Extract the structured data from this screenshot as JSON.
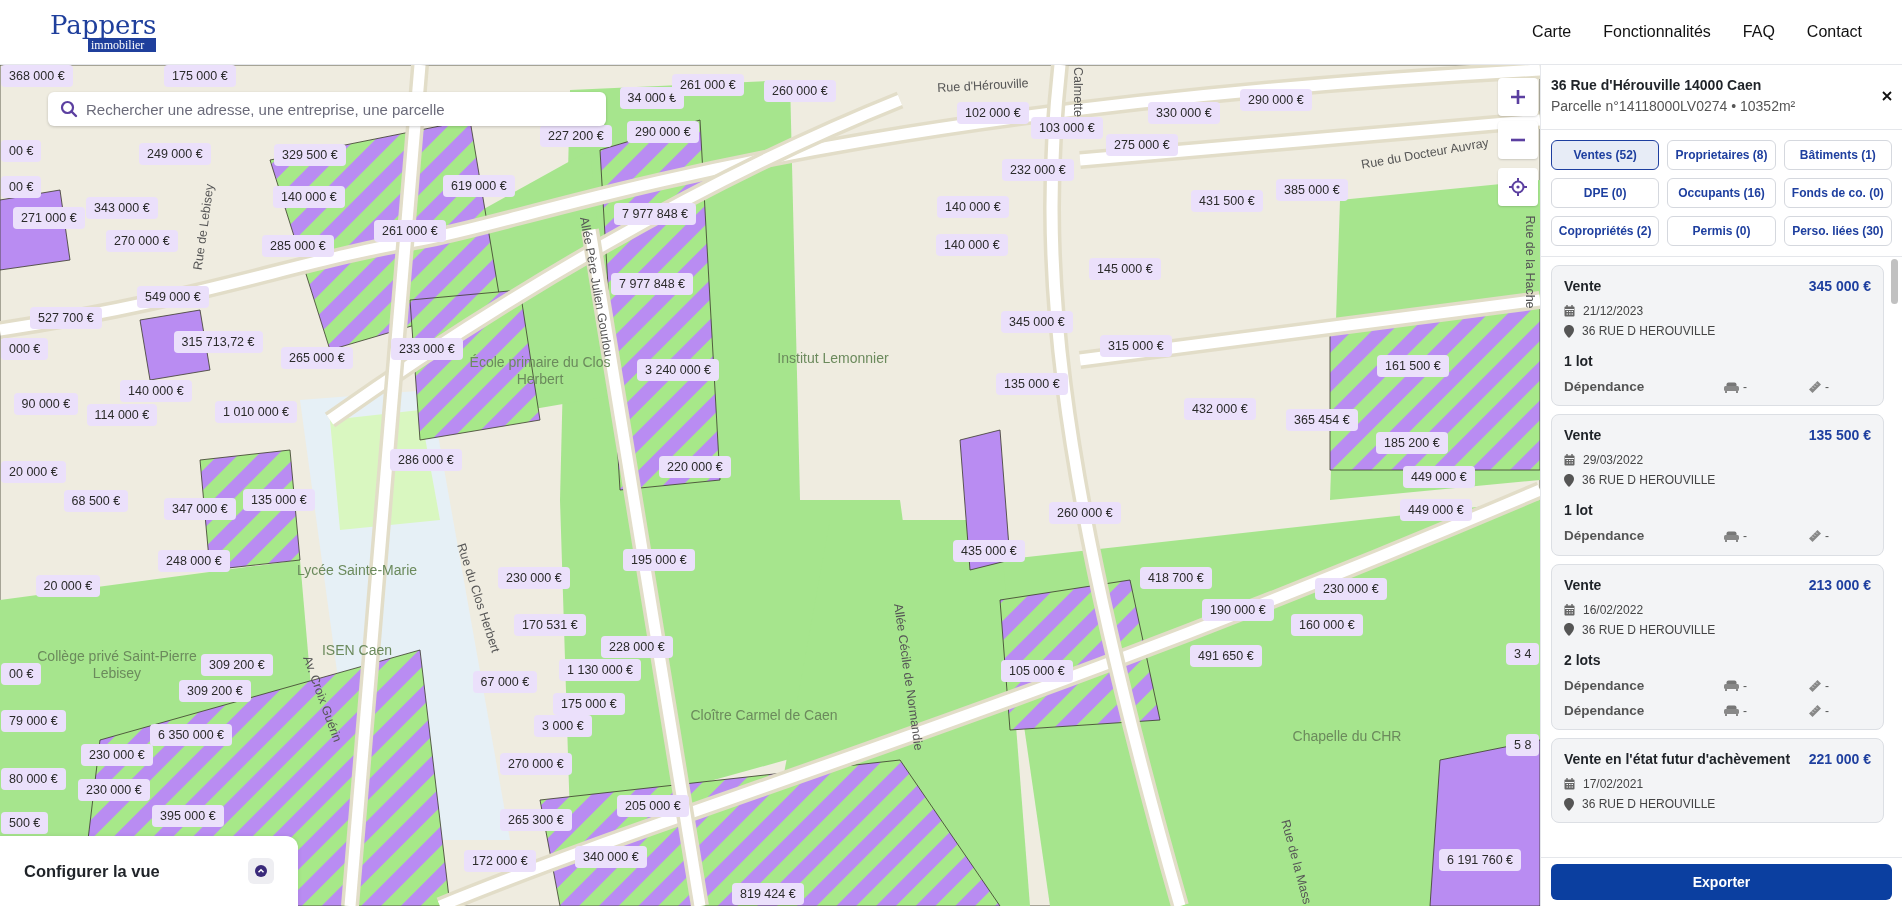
{
  "header": {
    "logo": {
      "name": "Pappers",
      "tag": "immobilier"
    },
    "nav": [
      {
        "label": "Carte"
      },
      {
        "label": "Fonctionnalités"
      },
      {
        "label": "FAQ"
      },
      {
        "label": "Contact"
      }
    ]
  },
  "map": {
    "search": {
      "placeholder": "Rechercher une adresse, une entreprise, une parcelle"
    },
    "price_labels": [
      "368 000 €",
      "175 000 €",
      "34 000 €",
      "261 000 €",
      "00 €",
      "249 000 €",
      "329 500 €",
      "227 200 €",
      "290 000 €",
      "00 €",
      "619 000 €",
      "140 000 €",
      "343 000 €",
      "271 000 €",
      "261 000 €",
      "7 977 848 €",
      "270 000 €",
      "285 000 €",
      "7 977 848 €",
      "549 000 €",
      "527 700 €",
      "000 €",
      "315 713,72 €",
      "233 000 €",
      "265 000 €",
      "3 240 000 €",
      "140 000 €",
      "90 000 €",
      "114 000 €",
      "1 010 000 €",
      "20 000 €",
      "286 000 €",
      "220 000 €",
      "260 000 €",
      "102 000 €",
      "103 000 €",
      "330 000 €",
      "290 000 €",
      "275 000 €",
      "232 000 €",
      "140 000 €",
      "431 500 €",
      "385 000 €",
      "140 000 €",
      "145 000 €",
      "345 000 €",
      "315 000 €",
      "161 500 €",
      "135 000 €",
      "432 000 €",
      "365 454 €",
      "185 200 €",
      "449 000 €",
      "68 500 €",
      "347 000 €",
      "135 000 €",
      "248 000 €",
      "20 000 €",
      "195 000 €",
      "230 000 €",
      "170 531 €",
      "228 000 €",
      "1 130 000 €",
      "67 000 €",
      "175 000 €",
      "3 000 €",
      "309 200 €",
      "309 200 €",
      "00 €",
      "79 000 €",
      "6 350 000 €",
      "230 000 €",
      "80 000 €",
      "230 000 €",
      "270 000 €",
      "205 000 €",
      "500 €",
      "265 300 €",
      "395 000 €",
      "172 000 €",
      "340 000 €",
      "819 424 €",
      "260 000 €",
      "435 000 €",
      "449 000 €",
      "418 700 €",
      "190 000 €",
      "230 000 €",
      "160 000 €",
      "491 650 €",
      "105 000 €",
      "3 4",
      "5 8",
      "6 191 760 €"
    ],
    "place_labels": [
      "École primaire du Clos Herbert",
      "Institut Lemonnier",
      "Lycée Sainte-Marie",
      "ISEN Caen",
      "Collège privé Saint-Pierre Lebisey",
      "Cloître Carmel de Caen",
      "Chapelle du CHR"
    ],
    "street_labels": [
      "Rue d'Hérouville",
      "Rue du Docteur Auvray",
      "Rue de la Hache",
      "Calmette",
      "Rue de Lebisey",
      "Allée Père Julien Gourlou",
      "Rue du Clos Herbert",
      "Av. Croix Guérin",
      "Allée Cécile de Normandie",
      "Rue de la Mass"
    ],
    "configure": {
      "title": "Configurer la vue"
    }
  },
  "panel": {
    "address": "36 Rue d'Hérouville 14000 Caen",
    "parcel": "Parcelle n°14118000LV0274 • 10352m²",
    "tabs": [
      {
        "label": "Ventes (52)",
        "selected": true
      },
      {
        "label": "Proprietaires (8)",
        "selected": false
      },
      {
        "label": "Bâtiments (1)",
        "selected": false
      },
      {
        "label": "DPE (0)",
        "selected": false
      },
      {
        "label": "Occupants (16)",
        "selected": false
      },
      {
        "label": "Fonds de co. (0)",
        "selected": false
      },
      {
        "label": "Copropriétés (2)",
        "selected": false
      },
      {
        "label": "Permis (0)",
        "selected": false
      },
      {
        "label": "Perso. liées (30)",
        "selected": false
      }
    ],
    "sales": [
      {
        "type": "Vente",
        "price": "345 000 €",
        "date": "21/12/2023",
        "address": "36 RUE D HEROUVILLE",
        "lots": "1 lot",
        "items": [
          {
            "label": "Dépendance",
            "rooms": "-",
            "area": "-"
          }
        ]
      },
      {
        "type": "Vente",
        "price": "135 500 €",
        "date": "29/03/2022",
        "address": "36 RUE D HEROUVILLE",
        "lots": "1 lot",
        "items": [
          {
            "label": "Dépendance",
            "rooms": "-",
            "area": "-"
          }
        ]
      },
      {
        "type": "Vente",
        "price": "213 000 €",
        "date": "16/02/2022",
        "address": "36 RUE D HEROUVILLE",
        "lots": "2 lots",
        "items": [
          {
            "label": "Dépendance",
            "rooms": "-",
            "area": "-"
          },
          {
            "label": "Dépendance",
            "rooms": "-",
            "area": "-"
          }
        ]
      },
      {
        "type": "Vente en l'état futur d'achèvement",
        "price": "221 000 €",
        "date": "17/02/2021",
        "address": "36 RUE D HEROUVILLE"
      }
    ],
    "export": "Exporter"
  }
}
